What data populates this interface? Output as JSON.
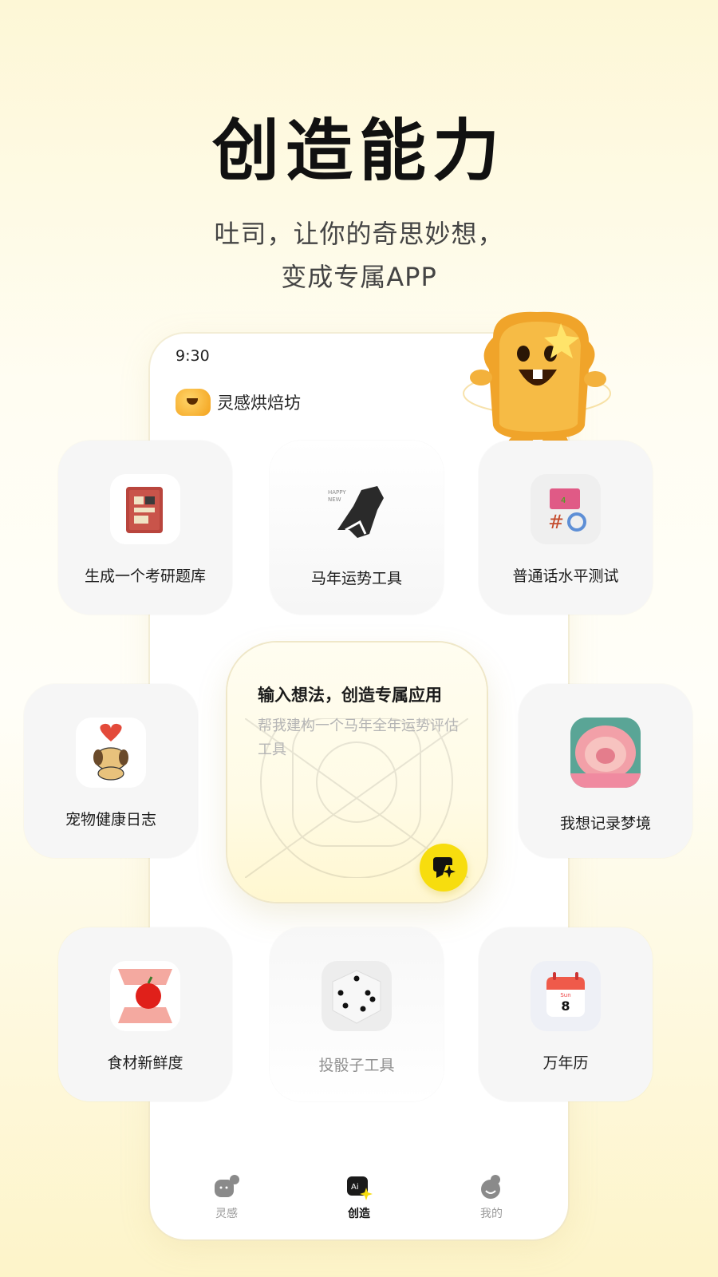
{
  "hero": {
    "title": "创造能力",
    "subtitle_line1": "吐司，让你的奇思妙想，",
    "subtitle_line2": "变成专属APP"
  },
  "phone": {
    "status_time": "9:30",
    "app_title": "灵感烘焙坊"
  },
  "cards": {
    "exam_bank": "生成一个考研题库",
    "horse_fortune": "马年运势工具",
    "mandarin_test": "普通话水平测试",
    "pet_health": "宠物健康日志",
    "dream_log": "我想记录梦境",
    "food_fresh": "食材新鲜度",
    "dice_tool": "投骰子工具",
    "calendar": "万年历"
  },
  "calendar_icon": {
    "day_label": "Sun",
    "day_number": "8"
  },
  "create_panel": {
    "title": "输入想法，创造专属应用",
    "placeholder": "帮我建构一个马年全年运势评估工具"
  },
  "tabs": [
    {
      "label": "灵感",
      "icon": "inspiration-icon",
      "active": false
    },
    {
      "label": "创造",
      "icon": "ai-create-icon",
      "active": true
    },
    {
      "label": "我的",
      "icon": "profile-icon",
      "active": false
    }
  ],
  "colors": {
    "accent_yellow": "#f7dd0e",
    "background_cream": "#fdf7d6",
    "card_gray": "#f6f6f6"
  }
}
